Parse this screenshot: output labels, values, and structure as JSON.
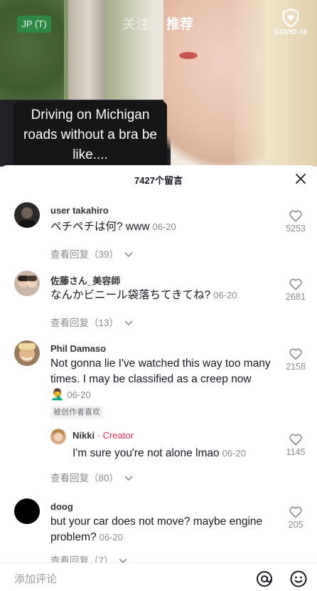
{
  "top": {
    "region_badge": "JP (T)",
    "tabs": [
      {
        "label": "关注",
        "active": false
      },
      {
        "label": "推荐",
        "active": true
      }
    ],
    "covid_label": "COVID-19"
  },
  "video": {
    "caption": "Driving on Michigan roads without a bra be like...."
  },
  "panel": {
    "title": "7427个留言",
    "close_icon": "close-icon"
  },
  "comments": [
    {
      "username": "user takahiro",
      "text": "ペチペチは何? www",
      "date": "06-20",
      "likes": "5253",
      "replies": "查看回复（39）"
    },
    {
      "username": "佐藤さん_美容師",
      "text": "なんかビニール袋落ちてきてね?",
      "date": "06-20",
      "likes": "2681",
      "replies": "查看回复（13）"
    },
    {
      "username": "Phil Damaso",
      "text": "Not gonna lie I've watched this way too many times. I may be classified as a creep now 🤦‍♂️",
      "date": "06-20",
      "likes": "2158",
      "badge": "被创作者喜欢",
      "reply": {
        "username": "Nikki",
        "separator": "·",
        "role": "Creator",
        "text": "I'm sure you're not alone lmao",
        "date": "06-20",
        "likes": "1145"
      },
      "replies": "查看回复（80）"
    },
    {
      "username": "doog",
      "text": "but your car does not move? maybe engine problem?",
      "date": "06-20",
      "likes": "205",
      "replies": "查看回复（7）"
    }
  ],
  "input": {
    "placeholder": "添加评论",
    "mention_icon": "at-icon",
    "emoji_icon": "emoji-icon"
  },
  "colors": {
    "accent": "#fe2c55",
    "muted": "#8a8b91",
    "badge_green": "#2d8e46"
  }
}
